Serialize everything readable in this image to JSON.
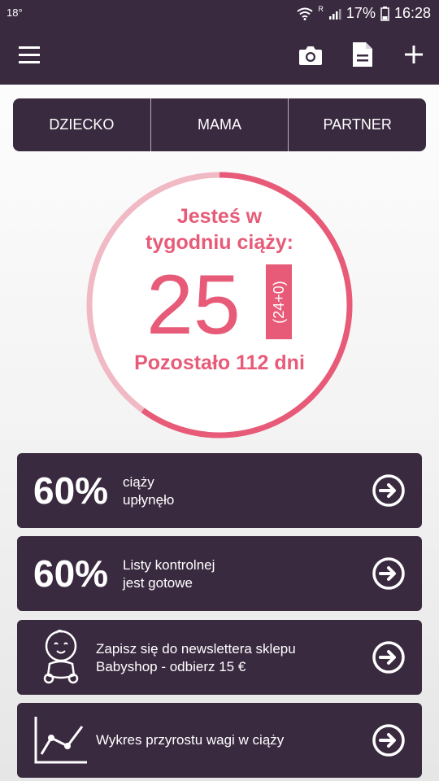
{
  "status_bar": {
    "temperature": "18°",
    "battery": "17%",
    "time": "16:28",
    "network": "R"
  },
  "tabs": [
    {
      "label": "DZIECKO"
    },
    {
      "label": "MAMA"
    },
    {
      "label": "PARTNER"
    }
  ],
  "pregnancy": {
    "title_line1": "Jesteś w",
    "title_line2": "tygodniu ciąży:",
    "week": "25",
    "exact_week": "(24+0)",
    "remaining": "Pozostało 112 dni",
    "progress_fraction": 0.6
  },
  "cards": [
    {
      "big": "60%",
      "line1": "ciąży",
      "line2": "upłynęło"
    },
    {
      "big": "60%",
      "line1": "Listy kontrolnej",
      "line2": "jest gotowe"
    },
    {
      "line1": "Zapisz się do newslettera sklepu",
      "line2": "Babyshop - odbierz 15 €",
      "icon": "baby-icon"
    },
    {
      "line1": "Wykres przyrostu wagi w ciąży",
      "icon": "chart-icon"
    }
  ],
  "colors": {
    "primary": "#3a2a40",
    "accent": "#e75b78",
    "accent_light": "#f0b9c4"
  }
}
